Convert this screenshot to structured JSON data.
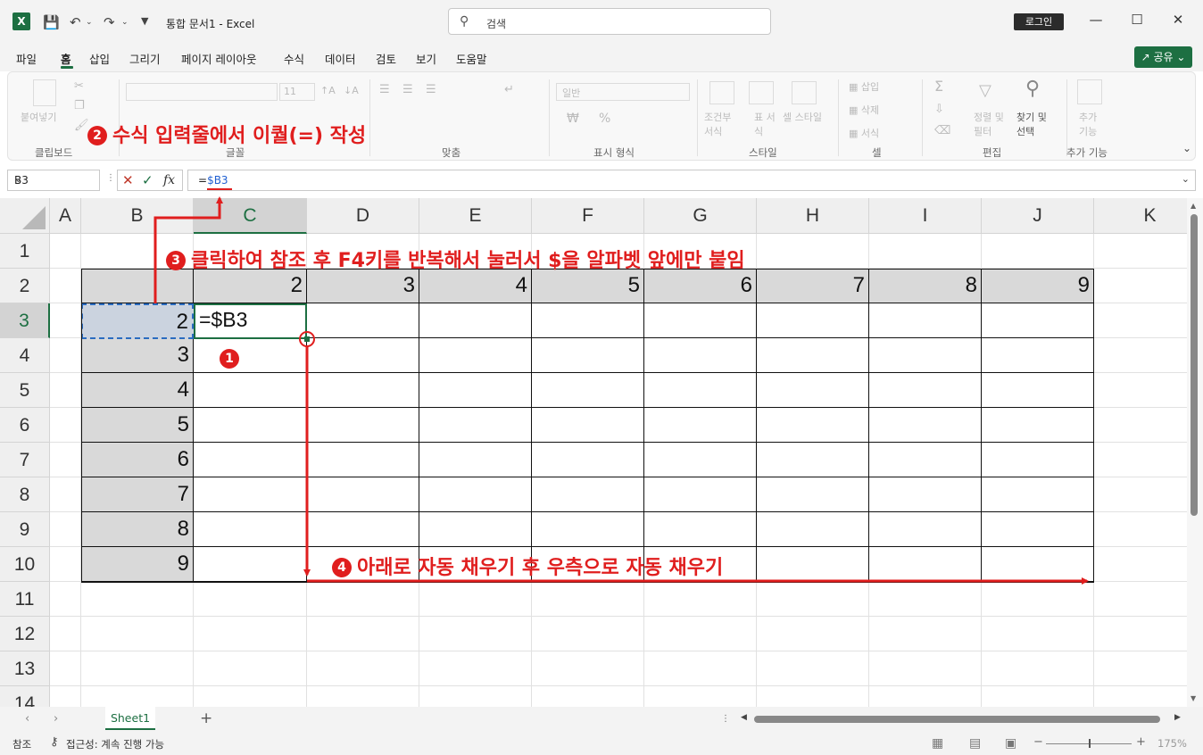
{
  "titlebar": {
    "app_icon": "X",
    "title": "통합 문서1  -  Excel",
    "search_placeholder": "검색",
    "login_label": "로그인",
    "icons": [
      "excel-logo-icon",
      "save-icon",
      "undo-icon",
      "redo-icon",
      "customize-icon",
      "search-icon",
      "minimize-icon",
      "maximize-icon",
      "close-icon"
    ]
  },
  "menu": {
    "items": [
      "파일",
      "홈",
      "삽입",
      "그리기",
      "페이지 레이아웃",
      "수식",
      "데이터",
      "검토",
      "보기",
      "도움말"
    ],
    "active": "홈",
    "share_label": "공유"
  },
  "ribbon": {
    "groups": [
      "클립보드",
      "글꼴",
      "맞춤",
      "표시 형식",
      "스타일",
      "셀",
      "편집",
      "추가 기능"
    ],
    "paste_label": "붙여넣기",
    "number_format": "일반",
    "font_size": "11",
    "conditional_format": "조건부 서식",
    "format_table": "표 서식",
    "cell_style": "셀 스타일",
    "insert": "삽입",
    "delete": "삭제",
    "format": "서식",
    "sort_filter": "정렬 및 필터",
    "find_select": "찾기 및 선택",
    "addins": "추가 기능"
  },
  "formula_bar": {
    "name_box": "B3",
    "formula_prefix": "=",
    "formula_ref": "$B3",
    "fx": "fx"
  },
  "grid": {
    "columns": [
      "A",
      "B",
      "C",
      "D",
      "E",
      "F",
      "G",
      "H",
      "I",
      "J",
      "K"
    ],
    "rows": [
      "1",
      "2",
      "3",
      "4",
      "5",
      "6",
      "7",
      "8",
      "9",
      "10",
      "11",
      "12",
      "13",
      "14"
    ],
    "active_column": "C",
    "active_row": "3",
    "row2_values": [
      "2",
      "3",
      "4",
      "5",
      "6",
      "7",
      "8",
      "9"
    ],
    "colB_values": [
      "2",
      "3",
      "4",
      "5",
      "6",
      "7",
      "8",
      "9"
    ],
    "active_cell_text": "=$B3"
  },
  "sheets": {
    "tabs": [
      "Sheet1"
    ],
    "add_label": "+"
  },
  "status": {
    "mode": "참조",
    "accessibility": "접근성: 계속 진행 가능",
    "zoom": "175%"
  },
  "annotations": {
    "step1_num": "1",
    "step2_num": "2",
    "step2_text": "수식 입력줄에서 이퀄(=) 작성",
    "step3_num": "3",
    "step3_text": "클릭하여 참조 후 F4키를 반복해서 눌러서 $을 알파벳 앞에만 붙임",
    "step4_num": "4",
    "step4_text": "아래로 자동 채우기 후 우측으로 자동 채우기"
  },
  "colors": {
    "excel_green": "#1d6f42",
    "annotation_red": "#e01e1e",
    "header_fill": "#d9d9d9",
    "ref_blue": "#2a6bc0"
  }
}
